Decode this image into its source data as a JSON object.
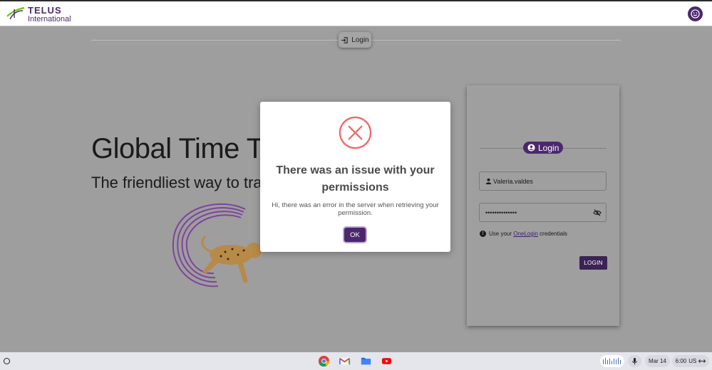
{
  "header": {
    "brand_name": "TELUS",
    "brand_sub": "International",
    "avatar_icon": "smiley-face-icon"
  },
  "nav": {
    "login_chip_label": "Login",
    "login_chip_icon": "login-arrow-icon"
  },
  "hero": {
    "title": "Global Time Track",
    "subtitle": "The friendliest way to track"
  },
  "login_card": {
    "title": "Login",
    "username_value": "Valeria.valdes",
    "password_value": "••••••••••••••",
    "hint_prefix": "Use your ",
    "hint_link": "OneLogin",
    "hint_suffix": " credentials",
    "login_button": "LOGIN"
  },
  "dialog": {
    "icon": "error-circle-x-icon",
    "title": "There was an issue with your permissions",
    "message": "Hi, there was an error in the server when retrieving your permission.",
    "ok_button": "OK"
  },
  "taskbar": {
    "apps": [
      "chrome-icon",
      "gmail-icon",
      "files-icon",
      "youtube-icon"
    ],
    "date": "Mar 14",
    "time": "6:00",
    "locale": "US"
  },
  "colors": {
    "brand_purple": "#4b286d",
    "brand_green": "#66cc00",
    "error_red": "#f06a6a",
    "overlay_gray": "#9e9e9e"
  }
}
